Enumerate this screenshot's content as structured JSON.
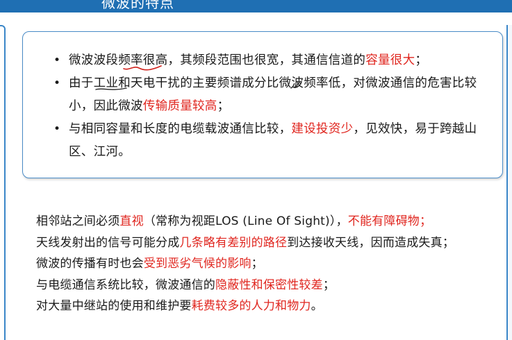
{
  "header": {
    "title": "微波的特点"
  },
  "advantages": [
    [
      {
        "text": "微波波段频率很高，其频段范围也很宽，其通信信道的",
        "red": false
      },
      {
        "text": "容量很大",
        "red": true
      },
      {
        "text": "；",
        "red": false
      }
    ],
    [
      {
        "text": "由于工业和天电干扰的主要频谱成分比微波频率低，对微波通信的危害比较小，因此微波",
        "red": false
      },
      {
        "text": "传输质量较高",
        "red": true
      },
      {
        "text": "；",
        "red": false
      }
    ],
    [
      {
        "text": "与相同容量和长度的电缆载波通信比较，",
        "red": false
      },
      {
        "text": "建设投资少",
        "red": true
      },
      {
        "text": "，见效快，易于跨越山区、江河。",
        "red": false
      }
    ]
  ],
  "disadvantages": [
    [
      {
        "text": "相邻站之间必须",
        "red": false
      },
      {
        "text": "直视",
        "red": true
      },
      {
        "text": "（常称为视距LOS (Line Of Sight)），",
        "red": false
      },
      {
        "text": "不能有障碍物；",
        "red": true
      }
    ],
    [
      {
        "text": "天线发射出的信号可能分成",
        "red": false
      },
      {
        "text": "几条略有差别的路径",
        "red": true
      },
      {
        "text": "到达接收天线，因而造成失真；",
        "red": false
      }
    ],
    [
      {
        "text": "微波的传播有时也会",
        "red": false
      },
      {
        "text": "受到恶劣气候的影响",
        "red": true
      },
      {
        "text": "；",
        "red": false
      }
    ],
    [
      {
        "text": "与电缆通信系统比较，微波通信的",
        "red": false
      },
      {
        "text": "隐蔽性和保密性较差",
        "red": true
      },
      {
        "text": "；",
        "red": false
      }
    ],
    [
      {
        "text": "对大量中继站的使用和维护要",
        "red": false
      },
      {
        "text": "耗费较多的人力和物力",
        "red": true
      },
      {
        "text": "。",
        "red": false
      }
    ]
  ],
  "colors": {
    "header_bar": "#1f6fb3",
    "box_border": "#4a8cc7",
    "highlight_red": "#e0261f",
    "ink_red": "#d0201a",
    "ink_dark": "#222222"
  }
}
